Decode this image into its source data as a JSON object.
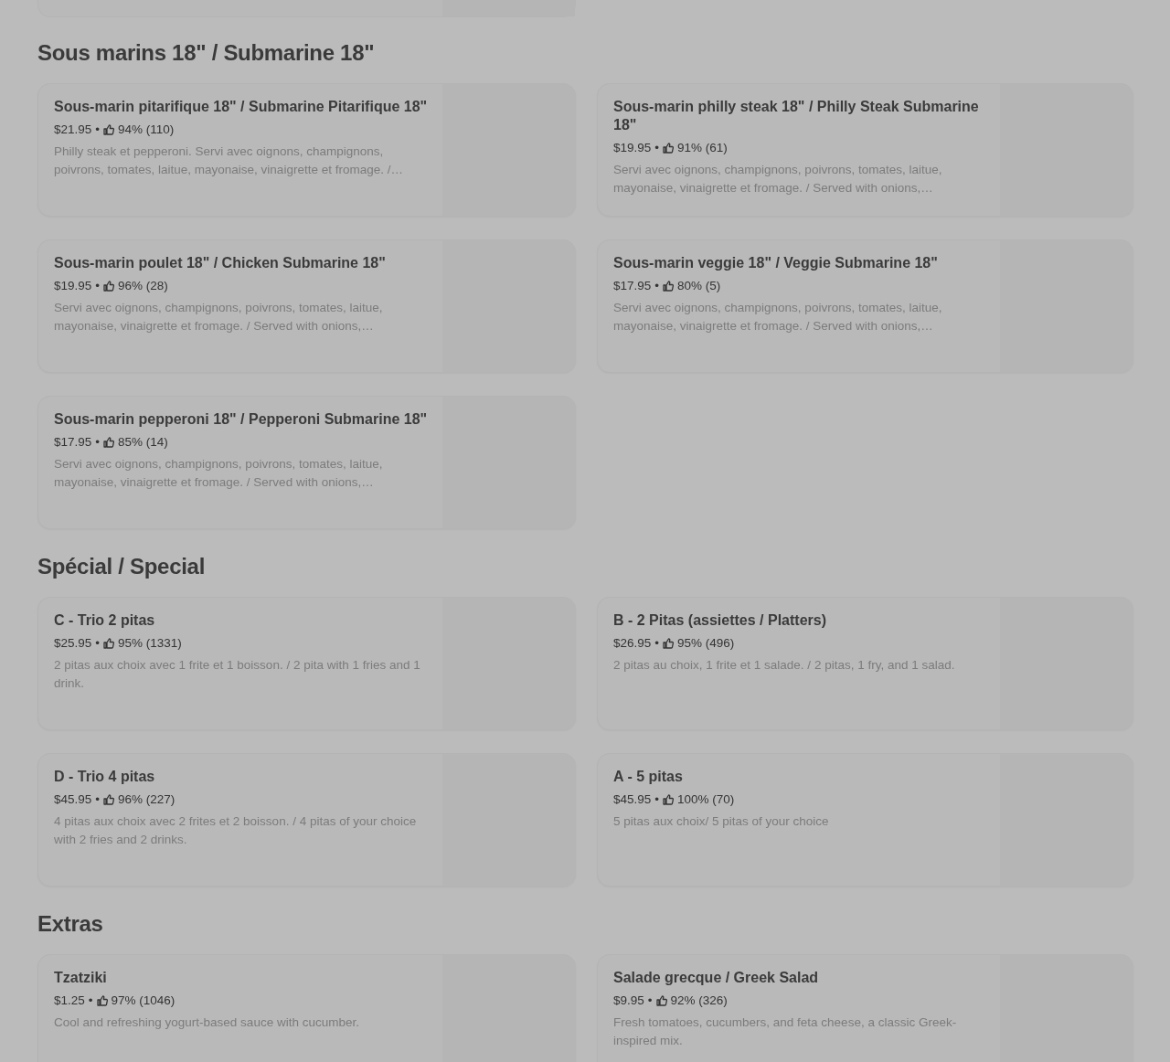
{
  "top_partial_card": {
    "kind": "card"
  },
  "sections": [
    {
      "title": "Sous marins 18\" / Submarine 18\"",
      "items": [
        {
          "name": "Sous-marin pitarifique 18\" / Submarine Pitarifique 18\"",
          "price": "$21.95",
          "separator": "•",
          "rating": "94% (110)",
          "description": "Philly steak et pepperoni. Servi avec oignons, champignons, poivrons, tomates, laitue, mayonaise, vinaigrette et fromage. /…"
        },
        {
          "name": "Sous-marin philly steak 18\" / Philly Steak Submarine 18\"",
          "price": "$19.95",
          "separator": "•",
          "rating": "91% (61)",
          "description": "Servi avec oignons, champignons, poivrons, tomates, laitue, mayonaise, vinaigrette et fromage. / Served with onions,…"
        },
        {
          "name": "Sous-marin poulet 18\" / Chicken Submarine 18\"",
          "price": "$19.95",
          "separator": "•",
          "rating": "96% (28)",
          "description": "Servi avec oignons, champignons, poivrons, tomates, laitue, mayonaise, vinaigrette et fromage. / Served with onions,…"
        },
        {
          "name": "Sous-marin veggie 18\" / Veggie Submarine 18\"",
          "price": "$17.95",
          "separator": "•",
          "rating": "80% (5)",
          "description": "Servi avec oignons, champignons, poivrons, tomates, laitue, mayonaise, vinaigrette et fromage. / Served with onions,…"
        },
        {
          "name": "Sous-marin pepperoni 18\" / Pepperoni Submarine 18\"",
          "price": "$17.95",
          "separator": "•",
          "rating": "85% (14)",
          "description": "Servi avec oignons, champignons, poivrons, tomates, laitue, mayonaise, vinaigrette et fromage. / Served with onions,…"
        }
      ]
    },
    {
      "title": "Spécial / Special",
      "items": [
        {
          "name": "C - Trio 2 pitas",
          "price": "$25.95",
          "separator": "•",
          "rating": "95% (1331)",
          "description": "2 pitas aux choix avec 1 frite et 1 boisson. / 2 pita with 1 fries and 1 drink."
        },
        {
          "name": "B - 2 Pitas (assiettes / Platters)",
          "price": "$26.95",
          "separator": "•",
          "rating": "95% (496)",
          "description": "2 pitas au choix, 1 frite et 1 salade. / 2 pitas, 1 fry, and 1 salad."
        },
        {
          "name": "D - Trio 4 pitas",
          "price": "$45.95",
          "separator": "•",
          "rating": "96% (227)",
          "description": "4 pitas aux choix avec 2 frites et 2 boisson. / 4 pitas of your choice with 2 fries and 2 drinks."
        },
        {
          "name": "A - 5 pitas",
          "price": "$45.95",
          "separator": "•",
          "rating": "100% (70)",
          "description": "5 pitas aux choix/ 5 pitas of your choice"
        }
      ]
    },
    {
      "title": "Extras",
      "items": [
        {
          "name": "Tzatziki",
          "price": "$1.25",
          "separator": "•",
          "rating": "97% (1046)",
          "description": "Cool and refreshing yogurt-based sauce with cucumber."
        },
        {
          "name": "Salade grecque / Greek Salad",
          "price": "$9.95",
          "separator": "•",
          "rating": "92% (326)",
          "description": "Fresh tomatoes, cucumbers, and feta cheese, a classic Greek-inspired mix."
        }
      ]
    }
  ]
}
